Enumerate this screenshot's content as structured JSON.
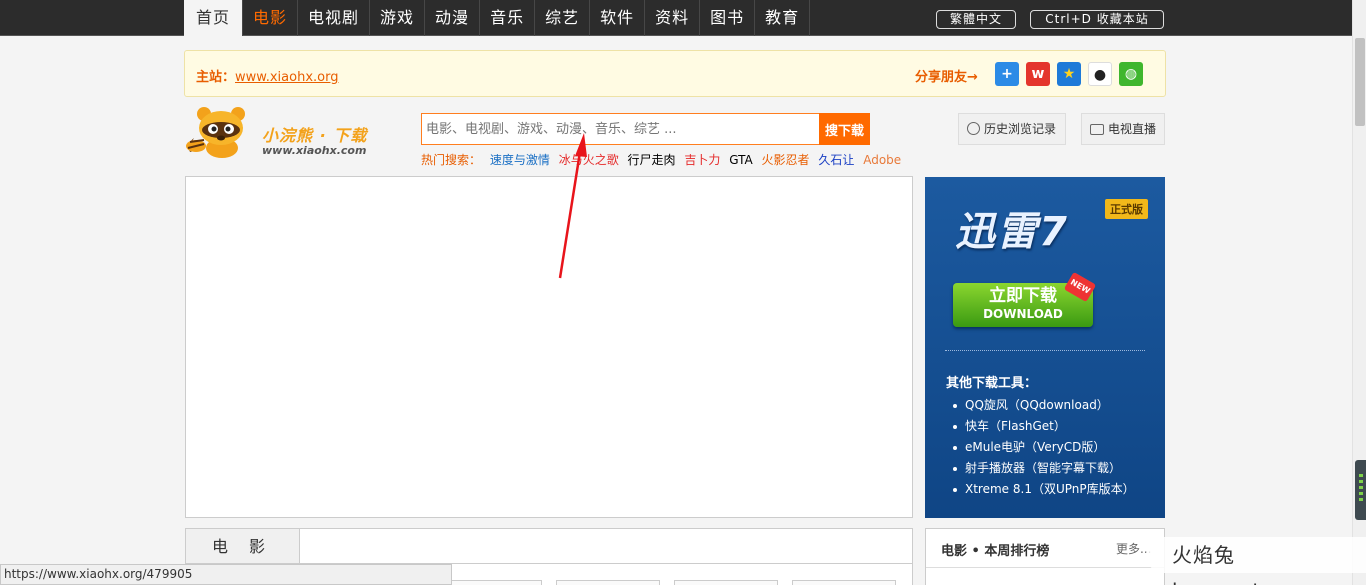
{
  "nav": {
    "items": [
      "首页",
      "电影",
      "电视剧",
      "游戏",
      "动漫",
      "音乐",
      "综艺",
      "软件",
      "资料",
      "图书",
      "教育"
    ],
    "traditional_label": "繁體中文",
    "favorite_label": "Ctrl+D 收藏本站"
  },
  "notice": {
    "main_prefix": "主站：",
    "main_link": "www.xiaohx.org",
    "share_label": "分享朋友→"
  },
  "logo": {
    "name": "小浣熊 · 下载",
    "url": "www.xiaohx.com"
  },
  "search": {
    "placeholder": "电影、电视剧、游戏、动漫、音乐、综艺 ...",
    "button": "搜下载",
    "hot_label": "热门搜索：",
    "hot_items": [
      {
        "text": "速度与激情",
        "color": "#1a6fc4"
      },
      {
        "text": "冰与火之歌",
        "color": "#e52a2a"
      },
      {
        "text": "行尸走肉",
        "color": "#000000"
      },
      {
        "text": "吉卜力",
        "color": "#e52a2a"
      },
      {
        "text": "GTA",
        "color": "#000000"
      },
      {
        "text": "火影忍者",
        "color": "#e85d00"
      },
      {
        "text": "久石让",
        "color": "#1a3fc4"
      },
      {
        "text": "Adobe",
        "color": "#e87a3a"
      }
    ]
  },
  "header_buttons": {
    "history": "历史浏览记录",
    "tv": "电视直播"
  },
  "ad": {
    "title": "迅雷7",
    "badge": "正式版",
    "download_cn": "立即下载",
    "download_en": "DOWNLOAD",
    "new": "NEW",
    "other_title": "其他下载工具：",
    "tools": [
      "QQ旋风（QQdownload）",
      "快车（FlashGet）",
      "eMule电驴（VeryCD版）",
      "射手播放器（智能字幕下载）",
      "Xtreme 8.1（双UPnP库版本）"
    ]
  },
  "movie": {
    "tab": "电 影"
  },
  "rank": {
    "title": "电影 • 本周排行榜",
    "more": "更多..."
  },
  "status_url": "https://www.xiaohx.org/479905",
  "watermark": "火焰兔 huoyantu.com"
}
